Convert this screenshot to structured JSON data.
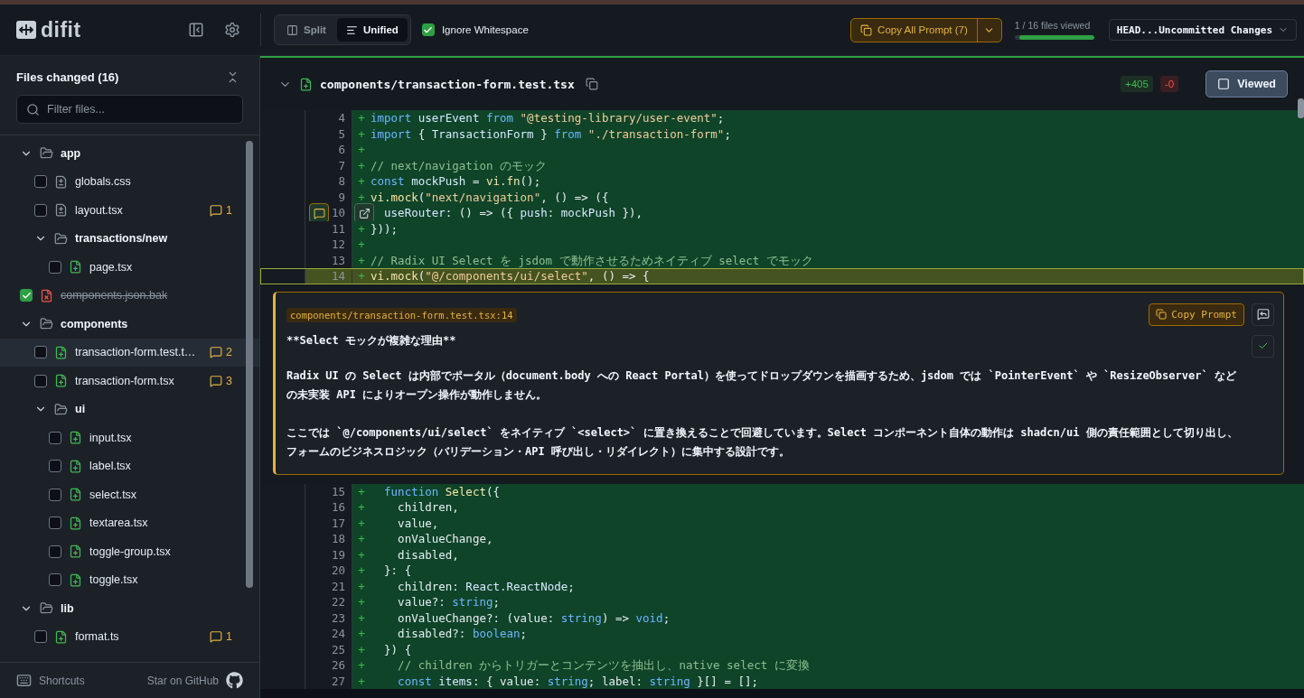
{
  "app": {
    "logo": "difit"
  },
  "toolbar": {
    "view_modes": [
      {
        "label": "Split",
        "kind": "split",
        "selected": false
      },
      {
        "label": "Unified",
        "kind": "unified",
        "selected": true
      }
    ],
    "ignore_whitespace": {
      "label": "Ignore Whitespace",
      "checked": true
    },
    "copy_all_prompt": {
      "label": "Copy All Prompt (7)"
    },
    "progress": {
      "label": "1 / 16 files viewed",
      "level": 0.94
    },
    "revision": {
      "label": "HEAD...Uncommitted Changes"
    }
  },
  "sidebar": {
    "title": "Files changed (16)",
    "filter": {
      "placeholder": "Filter files..."
    },
    "tree": [
      {
        "kind": "folder",
        "name": "app",
        "expanded": true,
        "children": [
          {
            "kind": "modified",
            "name": "globals.css",
            "checked": false,
            "selected": false
          },
          {
            "kind": "modified",
            "name": "layout.tsx",
            "checked": false,
            "selected": false,
            "comments": "1"
          },
          {
            "kind": "folder",
            "name": "transactions/new",
            "expanded": true,
            "children": [
              {
                "kind": "added",
                "name": "page.tsx",
                "checked": false,
                "selected": false
              }
            ]
          }
        ]
      },
      {
        "kind": "deleted",
        "name": "components.json.bak",
        "checked": true,
        "selected": false
      },
      {
        "kind": "folder",
        "name": "components",
        "expanded": true,
        "children": [
          {
            "kind": "added",
            "name": "transaction-form.test.t…",
            "checked": false,
            "selected": true,
            "comments": "2"
          },
          {
            "kind": "added",
            "name": "transaction-form.tsx",
            "checked": false,
            "selected": false,
            "comments": "3"
          },
          {
            "kind": "folder",
            "name": "ui",
            "expanded": true,
            "children": [
              {
                "kind": "added",
                "name": "input.tsx",
                "checked": false,
                "selected": false
              },
              {
                "kind": "added",
                "name": "label.tsx",
                "checked": false,
                "selected": false
              },
              {
                "kind": "added",
                "name": "select.tsx",
                "checked": false,
                "selected": false
              },
              {
                "kind": "added",
                "name": "textarea.tsx",
                "checked": false,
                "selected": false
              },
              {
                "kind": "added",
                "name": "toggle-group.tsx",
                "checked": false,
                "selected": false
              },
              {
                "kind": "added",
                "name": "toggle.tsx",
                "checked": false,
                "selected": false
              }
            ]
          }
        ]
      },
      {
        "kind": "folder",
        "name": "lib",
        "expanded": true,
        "children": [
          {
            "kind": "added",
            "name": "format.ts",
            "checked": false,
            "selected": false,
            "comments": "1"
          }
        ]
      }
    ],
    "footer": {
      "shortcuts": "Shortcuts",
      "github": "Star on GitHub"
    }
  },
  "diff": {
    "file": {
      "path": "components/transaction-form.test.tsx",
      "kind": "added",
      "expanded": true,
      "additions": "+405",
      "deletions": "-0",
      "viewed": false,
      "viewed_label": "Viewed"
    },
    "lines_before": [
      {
        "number": "4",
        "sign": "+",
        "highlighted": false,
        "tokens": [
          {
            "kind": "kw",
            "text": "import "
          },
          {
            "kind": "var",
            "text": "userEvent"
          },
          {
            "kind": "kw",
            "text": " from "
          },
          {
            "kind": "str",
            "text": "\"@testing-library/user-event\""
          },
          {
            "kind": "plain",
            "text": ";"
          }
        ]
      },
      {
        "number": "5",
        "sign": "+",
        "highlighted": false,
        "tokens": [
          {
            "kind": "kw",
            "text": "import "
          },
          {
            "kind": "plain",
            "text": "{ "
          },
          {
            "kind": "var",
            "text": "TransactionForm"
          },
          {
            "kind": "plain",
            "text": " } "
          },
          {
            "kind": "kw",
            "text": "from "
          },
          {
            "kind": "str",
            "text": "\"./transaction-form\""
          },
          {
            "kind": "plain",
            "text": ";"
          }
        ]
      },
      {
        "number": "6",
        "sign": "+",
        "highlighted": false
      },
      {
        "number": "7",
        "sign": "+",
        "highlighted": false,
        "tokens": [
          {
            "kind": "comment",
            "text": "// next/navigation のモック"
          }
        ]
      },
      {
        "number": "8",
        "sign": "+",
        "highlighted": false,
        "tokens": [
          {
            "kind": "kw",
            "text": "const "
          },
          {
            "kind": "var",
            "text": "mockPush"
          },
          {
            "kind": "plain",
            "text": " = "
          },
          {
            "kind": "fn",
            "text": "vi.fn"
          },
          {
            "kind": "plain",
            "text": "();"
          }
        ]
      },
      {
        "number": "9",
        "sign": "+",
        "highlighted": false,
        "tokens": [
          {
            "kind": "fn",
            "text": "vi.mock"
          },
          {
            "kind": "plain",
            "text": "("
          },
          {
            "kind": "str",
            "text": "\"next/navigation\""
          },
          {
            "kind": "plain",
            "text": ", () => ({"
          }
        ]
      },
      {
        "number": "10",
        "highlighted": false,
        "actions": true,
        "tokens": [
          {
            "kind": "var",
            "text": "  useRouter"
          },
          {
            "kind": "plain",
            "text": ": () => ({ "
          },
          {
            "kind": "var",
            "text": "push"
          },
          {
            "kind": "plain",
            "text": ": "
          },
          {
            "kind": "var",
            "text": "mockPush"
          },
          {
            "kind": "plain",
            "text": " }),"
          }
        ]
      },
      {
        "number": "11",
        "sign": "+",
        "highlighted": false,
        "tokens": [
          {
            "kind": "plain",
            "text": "}));"
          }
        ]
      },
      {
        "number": "12",
        "sign": "+",
        "highlighted": false
      },
      {
        "number": "13",
        "sign": "+",
        "highlighted": false,
        "tokens": [
          {
            "kind": "comment",
            "text": "// Radix UI Select を jsdom で動作させるためネイティブ select でモック"
          }
        ]
      },
      {
        "number": "14",
        "sign": "+",
        "highlighted": true,
        "tokens": [
          {
            "kind": "fn",
            "text": "vi.mock"
          },
          {
            "kind": "plain",
            "text": "("
          },
          {
            "kind": "str",
            "text": "\"@/components/ui/select\""
          },
          {
            "kind": "plain",
            "text": ", () => {"
          }
        ]
      }
    ],
    "comment": {
      "location": "components/transaction-form.test.tsx:14",
      "copy_label": "Copy Prompt",
      "paragraphs": [
        {
          "kind": "heading",
          "text": "**Select モックが複雑な理由**"
        },
        {
          "kind": "text",
          "text": "Radix UI の Select は内部でポータル（document.body への React Portal）を使ってドロップダウンを描画するため、jsdom では `PointerEvent` や `ResizeObserver` などの未実装 API によりオープン操作が動作しません。"
        },
        {
          "kind": "text",
          "text": "ここでは `@/components/ui/select` をネイティブ `<select>` に置き換えることで回避しています。Select コンポーネント自体の動作は shadcn/ui 側の責任範囲として切り出し、フォームのビジネスロジック（バリデーション・API 呼び出し・リダイレクト）に集中する設計です。"
        }
      ]
    },
    "lines_after": [
      {
        "number": "15",
        "sign": "+",
        "highlighted": false,
        "tokens": [
          {
            "kind": "kw",
            "text": "  function "
          },
          {
            "kind": "fn",
            "text": "Select"
          },
          {
            "kind": "plain",
            "text": "({"
          }
        ]
      },
      {
        "number": "16",
        "sign": "+",
        "highlighted": false,
        "tokens": [
          {
            "kind": "plain",
            "text": "    children,"
          }
        ]
      },
      {
        "number": "17",
        "sign": "+",
        "highlighted": false,
        "tokens": [
          {
            "kind": "plain",
            "text": "    value,"
          }
        ]
      },
      {
        "number": "18",
        "sign": "+",
        "highlighted": false,
        "tokens": [
          {
            "kind": "plain",
            "text": "    onValueChange,"
          }
        ]
      },
      {
        "number": "19",
        "sign": "+",
        "highlighted": false,
        "tokens": [
          {
            "kind": "plain",
            "text": "    disabled,"
          }
        ]
      },
      {
        "number": "20",
        "sign": "+",
        "highlighted": false,
        "tokens": [
          {
            "kind": "plain",
            "text": "  }: {"
          }
        ]
      },
      {
        "number": "21",
        "sign": "+",
        "highlighted": false,
        "tokens": [
          {
            "kind": "plain",
            "text": "    children: "
          },
          {
            "kind": "var",
            "text": "React.ReactNode"
          },
          {
            "kind": "plain",
            "text": ";"
          }
        ]
      },
      {
        "number": "22",
        "sign": "+",
        "highlighted": false,
        "tokens": [
          {
            "kind": "plain",
            "text": "    value?: "
          },
          {
            "kind": "type",
            "text": "string"
          },
          {
            "kind": "plain",
            "text": ";"
          }
        ]
      },
      {
        "number": "23",
        "sign": "+",
        "highlighted": false,
        "tokens": [
          {
            "kind": "plain",
            "text": "    onValueChange?: (value: "
          },
          {
            "kind": "type",
            "text": "string"
          },
          {
            "kind": "plain",
            "text": ") => "
          },
          {
            "kind": "type",
            "text": "void"
          },
          {
            "kind": "plain",
            "text": ";"
          }
        ]
      },
      {
        "number": "24",
        "sign": "+",
        "highlighted": false,
        "tokens": [
          {
            "kind": "plain",
            "text": "    disabled?: "
          },
          {
            "kind": "type",
            "text": "boolean"
          },
          {
            "kind": "plain",
            "text": ";"
          }
        ]
      },
      {
        "number": "25",
        "sign": "+",
        "highlighted": false,
        "tokens": [
          {
            "kind": "plain",
            "text": "  }) {"
          }
        ]
      },
      {
        "number": "26",
        "sign": "+",
        "highlighted": false,
        "tokens": [
          {
            "kind": "comment",
            "text": "    // children からトリガーとコンテンツを抽出し、native select に変換"
          }
        ]
      },
      {
        "number": "27",
        "sign": "+",
        "highlighted": false,
        "tokens": [
          {
            "kind": "kw",
            "text": "    const "
          },
          {
            "kind": "var",
            "text": "items"
          },
          {
            "kind": "plain",
            "text": ": { value: "
          },
          {
            "kind": "type",
            "text": "string"
          },
          {
            "kind": "plain",
            "text": "; label: "
          },
          {
            "kind": "type",
            "text": "string"
          },
          {
            "kind": "plain",
            "text": " }[] = [];"
          }
        ]
      }
    ]
  }
}
